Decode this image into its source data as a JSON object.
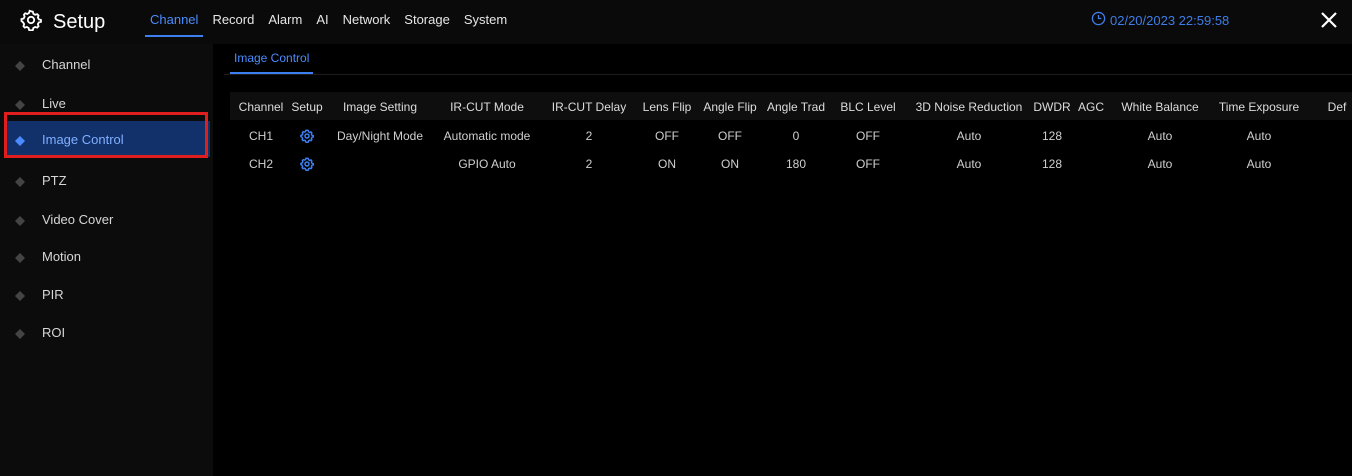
{
  "header": {
    "title": "Setup",
    "tabs": [
      "Channel",
      "Record",
      "Alarm",
      "AI",
      "Network",
      "Storage",
      "System"
    ],
    "active_tab": "Channel",
    "datetime": "02/20/2023 22:59:58"
  },
  "sidebar": {
    "items": [
      "Channel",
      "Live",
      "Image Control",
      "PTZ",
      "Video Cover",
      "Motion",
      "PIR",
      "ROI"
    ],
    "active_item": "Image Control"
  },
  "content": {
    "subtab": "Image Control",
    "table": {
      "columns": [
        "Channel",
        "Setup",
        "Image Setting",
        "IR-CUT Mode",
        "IR-CUT Delay",
        "Lens Flip",
        "Angle Flip",
        "Angle Trad",
        "BLC Level",
        "3D Noise Reduction",
        "DWDR",
        "AGC",
        "White Balance",
        "Time Exposure",
        "Def"
      ],
      "rows": [
        [
          "CH1",
          "",
          "Day/Night Mode",
          "Automatic mode",
          "2",
          "OFF",
          "OFF",
          "0",
          "OFF",
          "Auto",
          "128",
          "",
          "Auto",
          "Auto",
          ""
        ],
        [
          "CH2",
          "",
          "",
          "GPIO Auto",
          "2",
          "ON",
          "ON",
          "180",
          "OFF",
          "Auto",
          "128",
          "",
          "Auto",
          "Auto",
          ""
        ]
      ]
    }
  },
  "colors": {
    "accent": "#4a8cff",
    "active_bg": "#12306a",
    "highlight": "#e01e1e"
  },
  "icons": {
    "logo": "gear-icon",
    "datetime": "clock-icon",
    "close": "close-icon",
    "sidebar_bullet": "diamond-icon",
    "row_setup": "gear-icon"
  }
}
